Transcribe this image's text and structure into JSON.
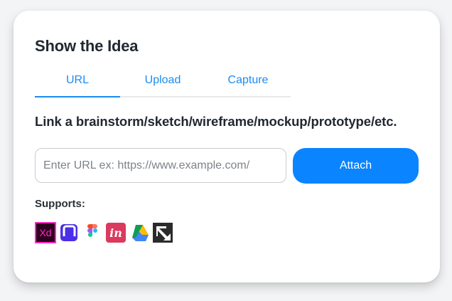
{
  "title": "Show the Idea",
  "tabs": [
    {
      "label": "URL",
      "active": true
    },
    {
      "label": "Upload",
      "active": false
    },
    {
      "label": "Capture",
      "active": false
    }
  ],
  "heading": "Link a brainstorm/sketch/wireframe/mockup/prototype/etc.",
  "url_input": {
    "placeholder": "Enter URL ex: https://www.example.com/",
    "value": ""
  },
  "attach_label": "Attach",
  "supports_label": "Supports:",
  "supported_icons": [
    "adobe-xd-icon",
    "framer-icon",
    "figma-icon",
    "invision-icon",
    "google-drive-icon",
    "zeplin-icon"
  ],
  "supported_icon_text": {
    "xd": "Xd",
    "invision": "in"
  },
  "colors": {
    "accent": "#0a84ff",
    "tab_text": "#1a8cf0",
    "title": "#222831"
  }
}
